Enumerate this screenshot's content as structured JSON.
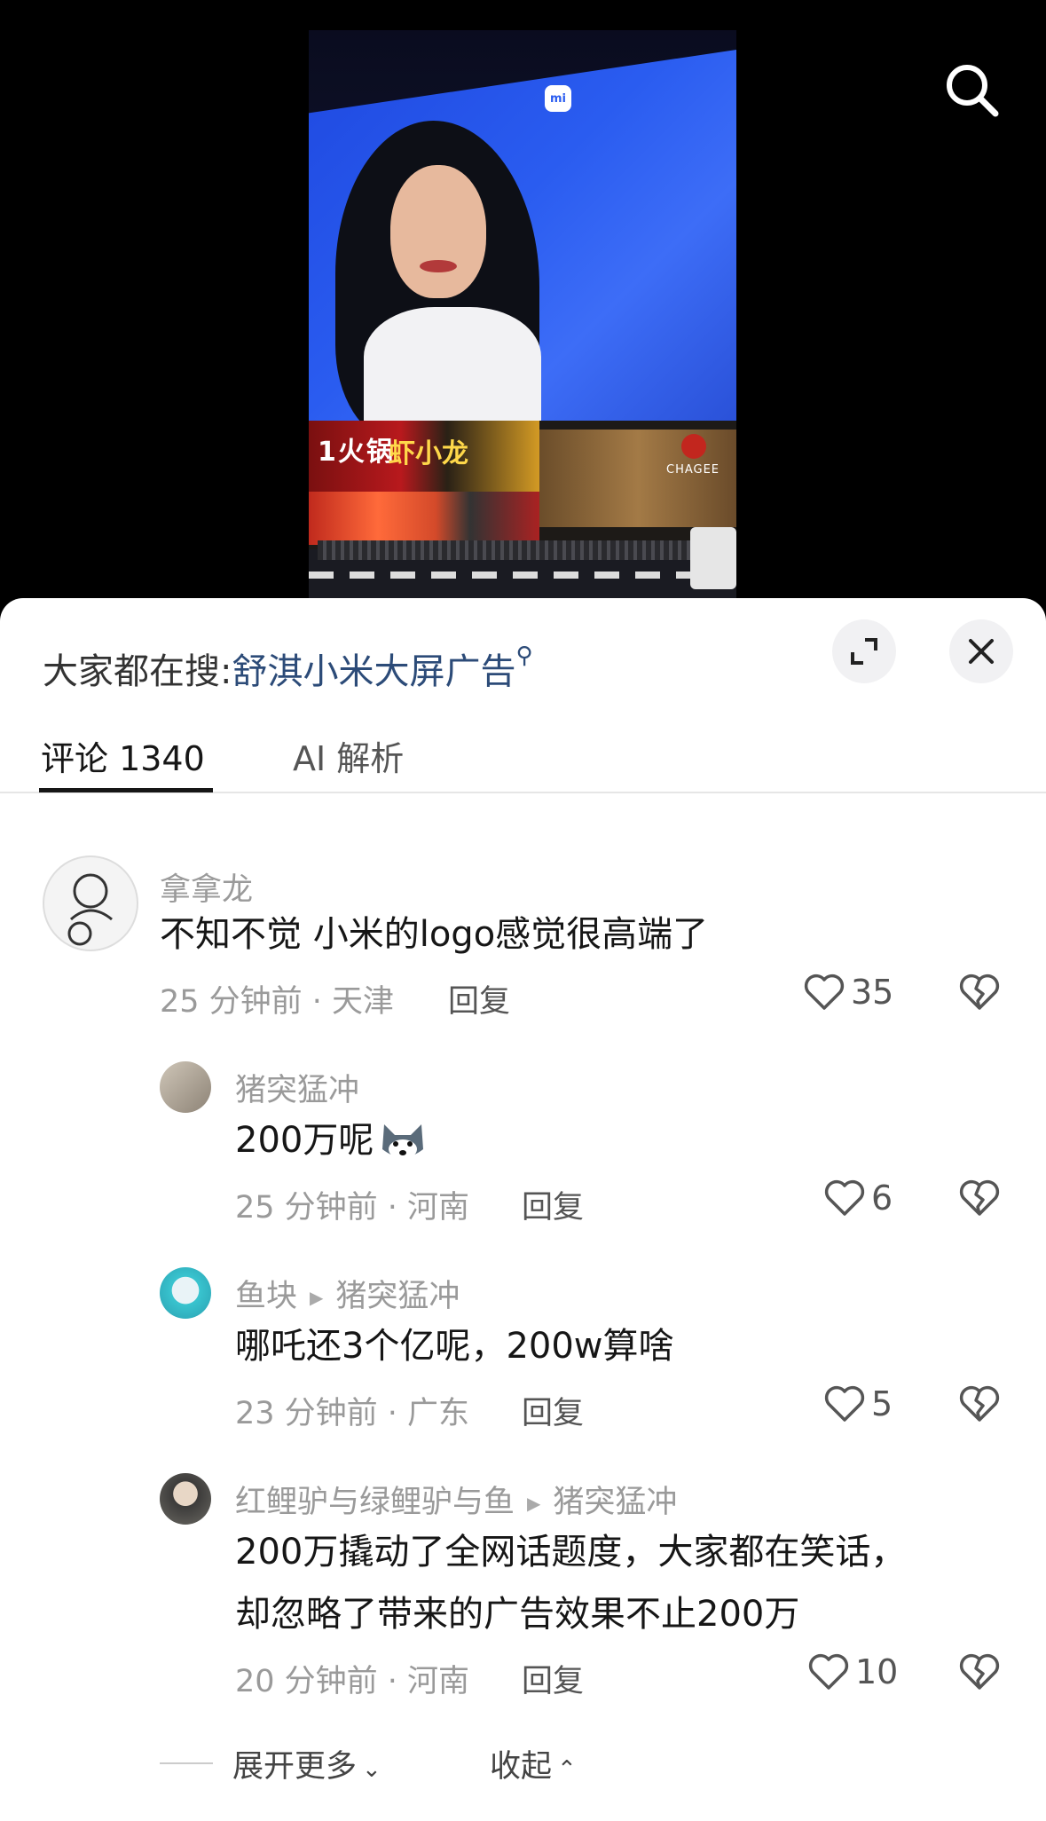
{
  "video": {
    "billboard_logo": "mi",
    "sign_left": "1火锅",
    "sign_main": "虾小龙",
    "shop_brand": "CHAGEE"
  },
  "sheet": {
    "hot_search_prefix": "大家都在搜:",
    "hot_search_term": "舒淇小米大屏广告",
    "tabs": [
      {
        "label": "评论 1340"
      },
      {
        "label": "AI 解析"
      }
    ]
  },
  "comments": [
    {
      "user": "拿拿龙",
      "text": "不知不觉  小米的logo感觉很高端了",
      "meta": "25 分钟前 · 天津",
      "reply": "回复",
      "likes": "35"
    },
    {
      "user": "猪突猛冲",
      "text": "200万呢",
      "meta": "25 分钟前 · 河南",
      "reply": "回复",
      "likes": "6"
    },
    {
      "user": "鱼块",
      "reply_to": "猪突猛冲",
      "text": "哪吒还3个亿呢，200w算啥",
      "meta": "23 分钟前 · 广东",
      "reply": "回复",
      "likes": "5"
    },
    {
      "user": "红鲤驴与绿鲤驴与鱼",
      "reply_to": "猪突猛冲",
      "text_line1": "200万撬动了全网话题度，大家都在笑话，",
      "text_line2": "却忽略了带来的广告效果不止200万",
      "meta": "20 分钟前 · 河南",
      "reply": "回复",
      "likes": "10"
    }
  ],
  "footer": {
    "expand_more": "展开更多",
    "collapse": "收起"
  }
}
